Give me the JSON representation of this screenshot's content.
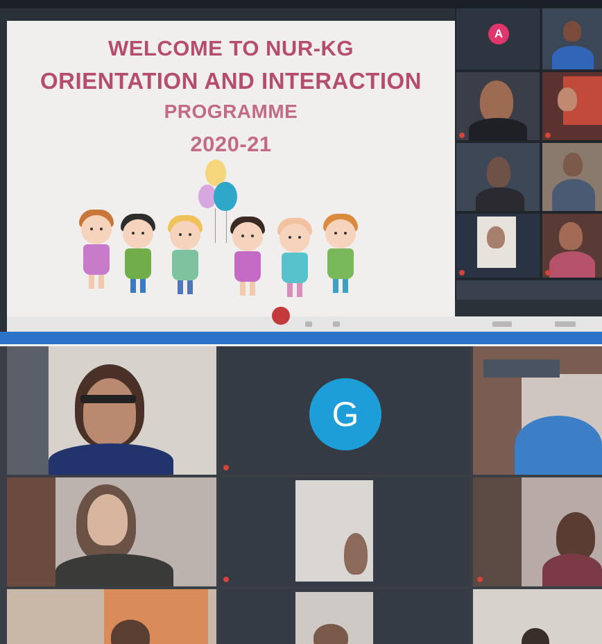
{
  "top_screenshot": {
    "slide": {
      "title_line1": "WELCOME TO NUR-KG",
      "title_line2": "ORIENTATION AND INTERACTION",
      "title_line3": "PROGRAMME",
      "year": "2020-21"
    },
    "participant_strip": {
      "first_tile_avatar_letter": "A"
    }
  },
  "bottom_screenshot": {
    "grid": {
      "center_avatar_letter": "G"
    }
  },
  "colors": {
    "title": "#b54d6e",
    "avatar_a": "#e0366b",
    "avatar_g": "#1e9ed8",
    "taskbar": "#2b73c9"
  }
}
